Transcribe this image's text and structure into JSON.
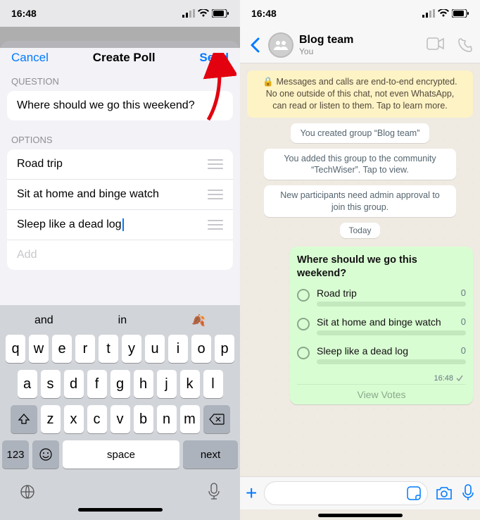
{
  "left": {
    "status": {
      "time": "16:48"
    },
    "modal": {
      "cancel": "Cancel",
      "title": "Create Poll",
      "send": "Send",
      "question_label": "QUESTION",
      "question": "Where should we go this weekend?",
      "options_label": "OPTIONS",
      "options": [
        "Road trip",
        "Sit at home and binge watch",
        "Sleep like a dead log"
      ],
      "add_placeholder": "Add"
    },
    "keyboard": {
      "predictions": [
        "and",
        "in",
        "🍂"
      ],
      "row1": [
        "q",
        "w",
        "e",
        "r",
        "t",
        "y",
        "u",
        "i",
        "o",
        "p"
      ],
      "row2": [
        "a",
        "s",
        "d",
        "f",
        "g",
        "h",
        "j",
        "k",
        "l"
      ],
      "row3": [
        "z",
        "x",
        "c",
        "v",
        "b",
        "n",
        "m"
      ],
      "num_key": "123",
      "space": "space",
      "next": "next"
    }
  },
  "right": {
    "status": {
      "time": "16:48"
    },
    "header": {
      "name": "Blog team",
      "sub": "You"
    },
    "encryption_banner": "🔒 Messages and calls are end-to-end encrypted. No one outside of this chat, not even WhatsApp, can read or listen to them. Tap to learn more.",
    "system_messages": [
      "You created group “Blog team”",
      "You added this group to the community “TechWiser”. Tap to view.",
      "New participants need admin approval to join this group."
    ],
    "date": "Today",
    "poll": {
      "question": "Where should we go this weekend?",
      "options": [
        {
          "label": "Road trip",
          "votes": "0"
        },
        {
          "label": "Sit at home and binge watch",
          "votes": "0"
        },
        {
          "label": "Sleep like a dead log",
          "votes": "0"
        }
      ],
      "time": "16:48",
      "view_votes": "View Votes"
    }
  }
}
